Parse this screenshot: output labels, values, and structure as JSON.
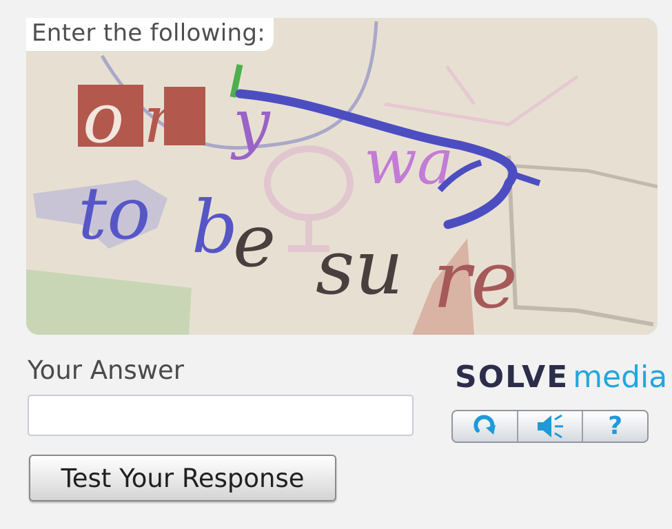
{
  "captcha": {
    "prompt": "Enter the following:",
    "image_phrase": "only way to be sure"
  },
  "answer": {
    "label": "Your Answer",
    "value": "",
    "placeholder": ""
  },
  "submit_label": "Test Your Response",
  "brand": {
    "solve": "SOLVE",
    "media": "media"
  },
  "toolbar": {
    "refresh_icon": "refresh-icon",
    "audio_icon": "audio-icon",
    "help_label": "?"
  },
  "colors": {
    "brand_dark": "#2b2d4a",
    "brand_accent": "#22a6df",
    "captcha_background": "#e7e0d2"
  }
}
